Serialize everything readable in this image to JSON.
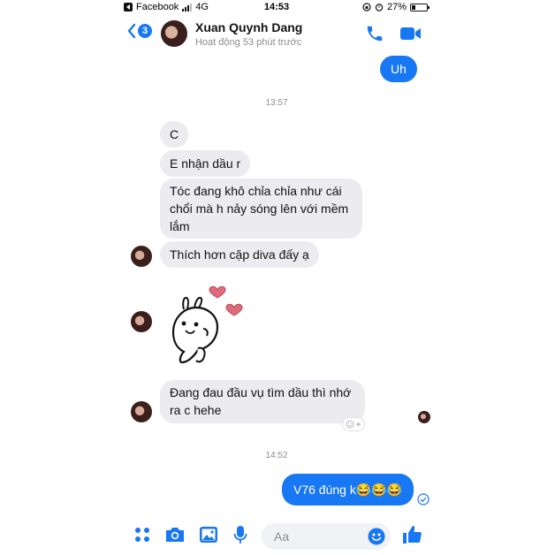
{
  "status_bar": {
    "carrier": "Facebook",
    "network": "4G",
    "time": "14:53",
    "battery": "27%",
    "battery_level": 0.27
  },
  "header": {
    "back_count": "3",
    "contact_name": "Xuan Quynh Dang",
    "contact_status": "Hoạt động 53 phút trước",
    "icons": [
      "phone-icon",
      "video-icon"
    ]
  },
  "messages": {
    "outgoing_1": "Uh",
    "time_1": "13:57",
    "incoming_1": "C",
    "incoming_2": "E nhận dầu r",
    "incoming_3_line1": "Tóc đang khô chỉa chỉa như cái",
    "incoming_3_line2": "chổi mà h nảy sóng lên với mềm",
    "incoming_3_line3": "lắm",
    "incoming_4": "Thích hơn cặp diva đấy ạ",
    "incoming_6_line1": "Đang đau đầu vụ tìm dầu thì nhớ",
    "incoming_6_line2": "ra c hehe",
    "time_2": "14:52",
    "outgoing_2": "V76 đúng k😂😂😂"
  },
  "composer": {
    "placeholder": "Aa",
    "icons": [
      "apps-icon",
      "camera-icon",
      "image-icon",
      "microphone-icon",
      "emoji-icon",
      "thumbs-up-icon"
    ]
  },
  "colors": {
    "accent": "#1877f2",
    "incoming_bubble": "#ececf0",
    "muted_text": "#8a8d91",
    "heart": "#e06b7a"
  }
}
